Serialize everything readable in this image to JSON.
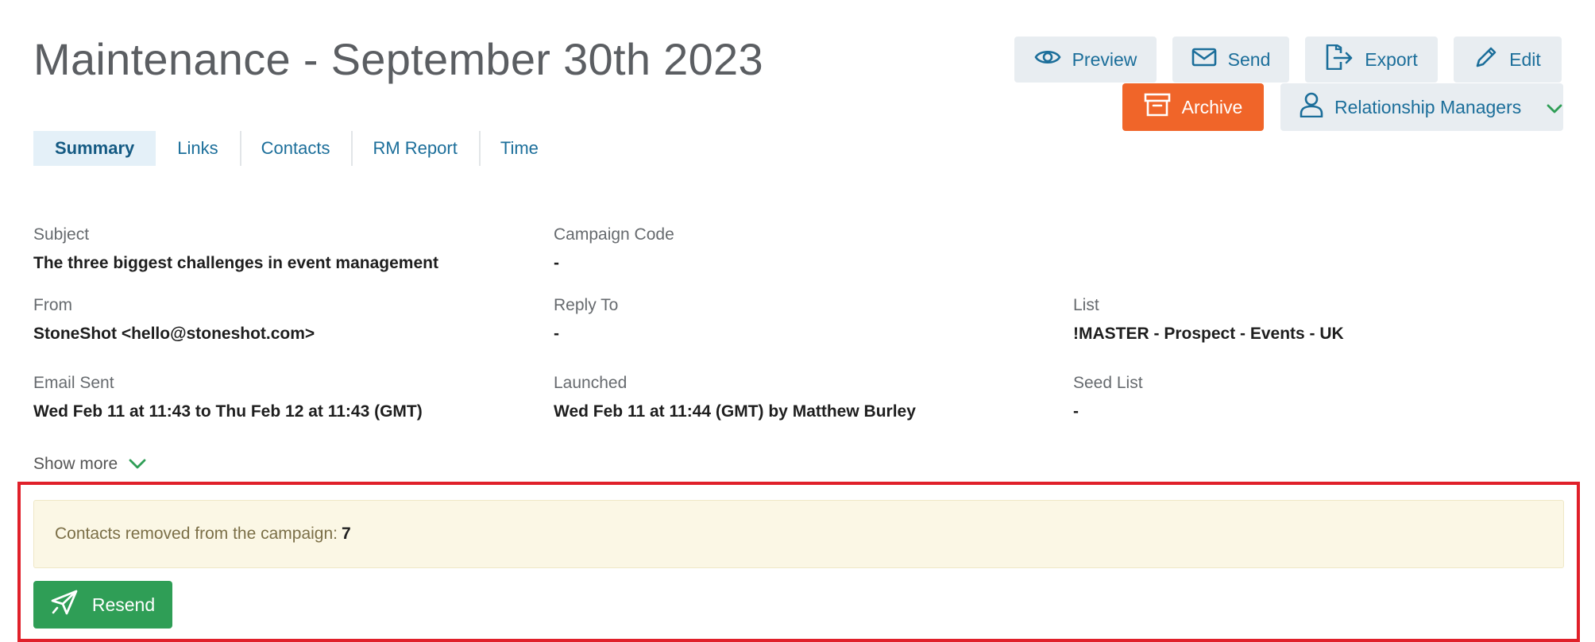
{
  "page_title": "Maintenance - September 30th 2023",
  "toolbar": {
    "preview_label": "Preview",
    "send_label": "Send",
    "export_label": "Export",
    "edit_label": "Edit",
    "archive_label": "Archive",
    "rm_label": "Relationship Managers"
  },
  "tabs": [
    {
      "label": "Summary",
      "active": true
    },
    {
      "label": "Links",
      "active": false
    },
    {
      "label": "Contacts",
      "active": false
    },
    {
      "label": "RM Report",
      "active": false
    },
    {
      "label": "Time",
      "active": false
    }
  ],
  "summary": {
    "subject": {
      "label": "Subject",
      "value": "The three biggest challenges in event management"
    },
    "campaign_code": {
      "label": "Campaign Code",
      "value": "-"
    },
    "from": {
      "label": "From",
      "value": "StoneShot <hello@stoneshot.com>"
    },
    "reply_to": {
      "label": "Reply To",
      "value": "-"
    },
    "list": {
      "label": "List",
      "value": "!MASTER - Prospect - Events - UK"
    },
    "email_sent": {
      "label": "Email Sent",
      "value": "Wed Feb 11 at 11:43 to Thu Feb 12 at 11:43 (GMT)"
    },
    "launched": {
      "label": "Launched",
      "value": "Wed Feb 11 at 11:44 (GMT) by Matthew Burley"
    },
    "seed_list": {
      "label": "Seed List",
      "value": "-"
    }
  },
  "show_more_label": "Show more",
  "notice": {
    "text": "Contacts removed from the campaign:",
    "count": "7"
  },
  "resend_label": "Resend",
  "colors": {
    "accent_blue": "#1b6e9a",
    "archive_orange": "#f06529",
    "resend_green": "#2f9e56",
    "chevron_green": "#2f9e56",
    "highlight_red": "#e0202a",
    "notice_bg": "#fbf7e5"
  },
  "icons": {
    "preview": "eye-icon",
    "send": "envelope-icon",
    "export": "export-icon",
    "edit": "pencil-icon",
    "archive": "archive-box-icon",
    "rm": "user-icon",
    "rm_dropdown": "chevron-down-icon",
    "show_more": "chevron-down-icon",
    "resend": "paper-plane-icon"
  }
}
